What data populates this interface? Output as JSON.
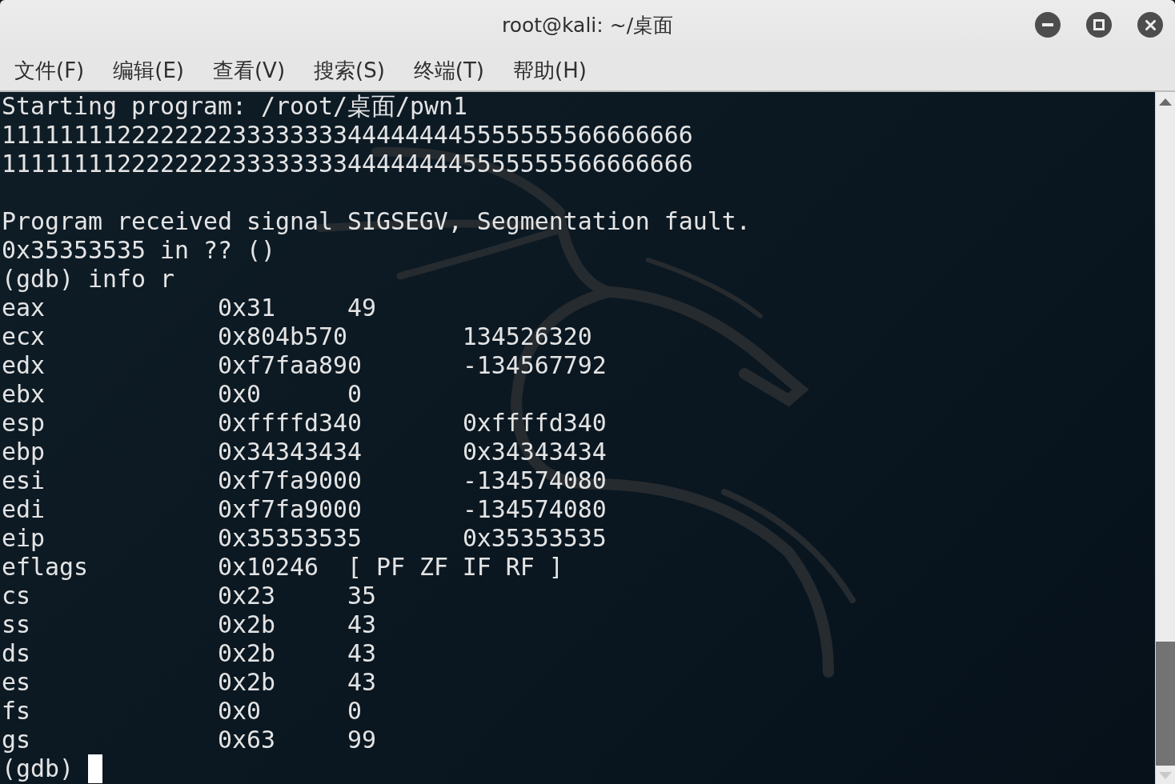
{
  "window": {
    "title": "root@kali: ~/桌面",
    "buttons": [
      {
        "kind": "minimize"
      },
      {
        "kind": "maximize"
      },
      {
        "kind": "close"
      }
    ]
  },
  "menu_bar": {
    "items": [
      "文件(F)",
      "编辑(E)",
      "查看(V)",
      "搜索(S)",
      "终端(T)",
      "帮助(H)"
    ]
  },
  "terminal": {
    "lines": [
      {
        "kind": "text",
        "text": "Starting program: /root/桌面/pwn1"
      },
      {
        "kind": "text",
        "text": "111111112222222233333333444444445555555566666666"
      },
      {
        "kind": "text",
        "text": "111111112222222233333333444444445555555566666666"
      },
      {
        "kind": "blank"
      },
      {
        "kind": "text",
        "text": "Program received signal SIGSEGV, Segmentation fault."
      },
      {
        "kind": "text",
        "text": "0x35353535 in ?? ()"
      },
      {
        "kind": "text",
        "text": "(gdb) info r"
      }
    ],
    "registers": [
      {
        "name": "eax",
        "hex": "0x31",
        "value": "49"
      },
      {
        "name": "ecx",
        "hex": "0x804b570",
        "value": "134526320"
      },
      {
        "name": "edx",
        "hex": "0xf7faa890",
        "value": "-134567792"
      },
      {
        "name": "ebx",
        "hex": "0x0",
        "value": "0"
      },
      {
        "name": "esp",
        "hex": "0xffffd340",
        "value": "0xffffd340"
      },
      {
        "name": "ebp",
        "hex": "0x34343434",
        "value": "0x34343434"
      },
      {
        "name": "esi",
        "hex": "0xf7fa9000",
        "value": "-134574080"
      },
      {
        "name": "edi",
        "hex": "0xf7fa9000",
        "value": "-134574080"
      },
      {
        "name": "eip",
        "hex": "0x35353535",
        "value": "0x35353535"
      },
      {
        "name": "eflags",
        "hex": "0x10246",
        "value": "[ PF ZF IF RF ]"
      },
      {
        "name": "cs",
        "hex": "0x23",
        "value": "35"
      },
      {
        "name": "ss",
        "hex": "0x2b",
        "value": "43"
      },
      {
        "name": "ds",
        "hex": "0x2b",
        "value": "43"
      },
      {
        "name": "es",
        "hex": "0x2b",
        "value": "43"
      },
      {
        "name": "fs",
        "hex": "0x0",
        "value": "0"
      },
      {
        "name": "gs",
        "hex": "0x63",
        "value": "99"
      }
    ],
    "prompt": {
      "text": "(gdb)",
      "cursor": true
    }
  }
}
